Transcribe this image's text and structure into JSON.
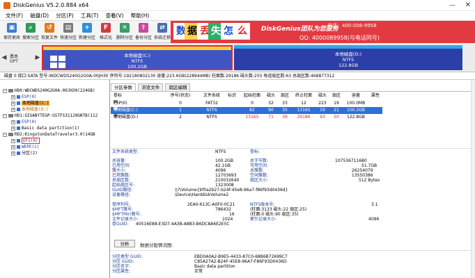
{
  "window": {
    "title": "DiskGenius V5.2.0.884 x64",
    "minimize": "—",
    "close": "✕"
  },
  "menu": [
    "文件(F)",
    "磁盘(D)",
    "分区(P)",
    "工具(T)",
    "查看(V)",
    "帮助(H)"
  ],
  "toolbar": [
    {
      "label": "保存更改",
      "icon": "save-icon",
      "color": "#3a7bd5"
    },
    {
      "label": "搜索分区",
      "icon": "search-icon",
      "color": "#2e9b57"
    },
    {
      "label": "恢复文件",
      "icon": "recover-icon",
      "color": "#e07b1e"
    },
    {
      "label": "快速分区",
      "icon": "quick-partition-icon",
      "color": "#7a7a7a"
    },
    {
      "label": "新建分区",
      "icon": "new-partition-icon",
      "color": "#2f8fd6"
    },
    {
      "label": "格式化",
      "icon": "format-icon",
      "color": "#d23b3b"
    },
    {
      "label": "删除分区",
      "icon": "delete-icon",
      "color": "#3a9d6a"
    },
    {
      "label": "备份分区",
      "icon": "backup-icon",
      "color": "#c94a9c"
    },
    {
      "label": "系统迁移",
      "icon": "migrate-icon",
      "color": "#4a6fb3"
    }
  ],
  "banner": {
    "tiles": [
      "数",
      "据",
      "丢",
      "失",
      "怎",
      "么"
    ],
    "brand": "DiskGenius团队为您服务",
    "phone": "电话：400-008-9958",
    "qq": "QQ: 4000089958(与电话同号)"
  },
  "diskmap": {
    "basic_label": "基本",
    "gpt_label": "GPT",
    "partC": {
      "name": "本地磁盘(C:)",
      "fs": "NTFS",
      "size": "100.2GB"
    },
    "partD": {
      "name": "本地磁盘(D:)",
      "fs": "NTFS",
      "size": "122.8GB"
    }
  },
  "infobar": "磁盘 0 接口:SATA  型号:WDCWDS240G2G0A-00JH30  序列号:192180802130  容量:223.6GB(228944MB)  柱面数:29186  磁头数:255  每道扇区数:63  总扇区数:468877312",
  "tree": {
    "hd0": "HD0:WDCWDS240G2G0A-00JH30(224GB)",
    "hd0_parts": [
      "ESP(0)",
      "本地磁盘(C:)",
      "本地磁盘(D:)"
    ],
    "hd1": "HD1:GIGABYTEGP-GSTFS31120GNTB(112",
    "hd1_parts": [
      "ESP(0)",
      "Basic data partition(1)"
    ],
    "rd2": "RD2:KingstonDataTraveler3.0(14GB",
    "rd2_parts": [
      "EFI(0)",
      "WEPE(1)",
      "分区(2)"
    ]
  },
  "tabs": [
    "分区参数",
    "浏览文件",
    "扇区编辑"
  ],
  "table": {
    "headers": [
      "卷标",
      "序号(状态)",
      "文件系统",
      "标识",
      "起始柱面",
      "磁头",
      "扇区",
      "终止柱面",
      "磁头",
      "扇区",
      "容量",
      "属性"
    ],
    "rows": [
      [
        "ESP(0)",
        "0",
        "FAT32",
        "",
        "0",
        "32",
        "33",
        "12",
        "223",
        "19",
        "100.0MB",
        ""
      ],
      [
        "本地磁盘(C:)",
        "1",
        "NTFS",
        "",
        "82",
        "90",
        "35",
        "13165",
        "19",
        "21",
        "100.2GB",
        ""
      ],
      [
        "本地磁盘(D:)",
        "2",
        "NTFS",
        "",
        "13165",
        "71",
        "36",
        "29186",
        "93",
        "50",
        "122.8GB",
        ""
      ]
    ]
  },
  "fsinfo": {
    "fs_label": "文件系统类型:",
    "fs_value": "NTFS",
    "vol_label": "卷标:",
    "left": [
      [
        "总容量:",
        "100.2GB"
      ],
      [
        "已用空间:",
        "42.1GB"
      ],
      [
        "簇大小:",
        "4096"
      ],
      [
        "已用簇数:",
        "12703693"
      ],
      [
        "总扇区数:",
        "210032640"
      ],
      [
        "起始扇区号:",
        "1323008"
      ]
    ],
    "right": [
      [
        "总字节数:",
        "107536711680"
      ],
      [
        "可用空间:",
        "51.7GB"
      ],
      [
        "总簇数:",
        "26254079"
      ],
      [
        "空闲簇数:",
        "13550386"
      ],
      [
        "扇区大小:",
        "512 Bytes"
      ]
    ],
    "guid_path_label": "GUID路径:",
    "guid_path": "\\\\?\\Volume{bf0a2b27-b24f-45e8-96a7-f86f93d0436d}",
    "device_label": "设备路径:",
    "device_path": "\\Device\\HarddiskVolume2",
    "left2": [
      [
        "卷序列号:",
        "2EA0-613C-A0F0-0C21"
      ],
      [
        "$MFT簇号:",
        "786432"
      ],
      [
        "$MFTMirr簇号:",
        "16"
      ],
      [
        "文件记录大小:",
        "1024"
      ],
      [
        "卷GUID:",
        "40516E88-E3D7-4A3B-A8B3-B6DC8A6E2E5C"
      ]
    ],
    "right2": [
      [
        "NTFS版本号:",
        "3.1"
      ],
      [
        "(柱面:3133 磁头:22 扇区:25)",
        ""
      ],
      [
        "(柱面:0 磁头:90 扇区:35)",
        ""
      ],
      [
        "索引记录大小:",
        "4096"
      ],
      [
        "",
        ""
      ]
    ]
  },
  "analyze": {
    "button": "分析",
    "text": "数据分配情况图:"
  },
  "guids": [
    [
      "分区类型 GUID:",
      "EBD0A0A2-B9E5-4433-87C0-68B6B72699C7"
    ],
    [
      "分区 GUID:",
      "C85A27A2-B24F-45E8-96A7-F86F93D0436D"
    ],
    [
      "分区名字:",
      "Basic data partition"
    ],
    [
      "分区属性:",
      "正常"
    ]
  ]
}
